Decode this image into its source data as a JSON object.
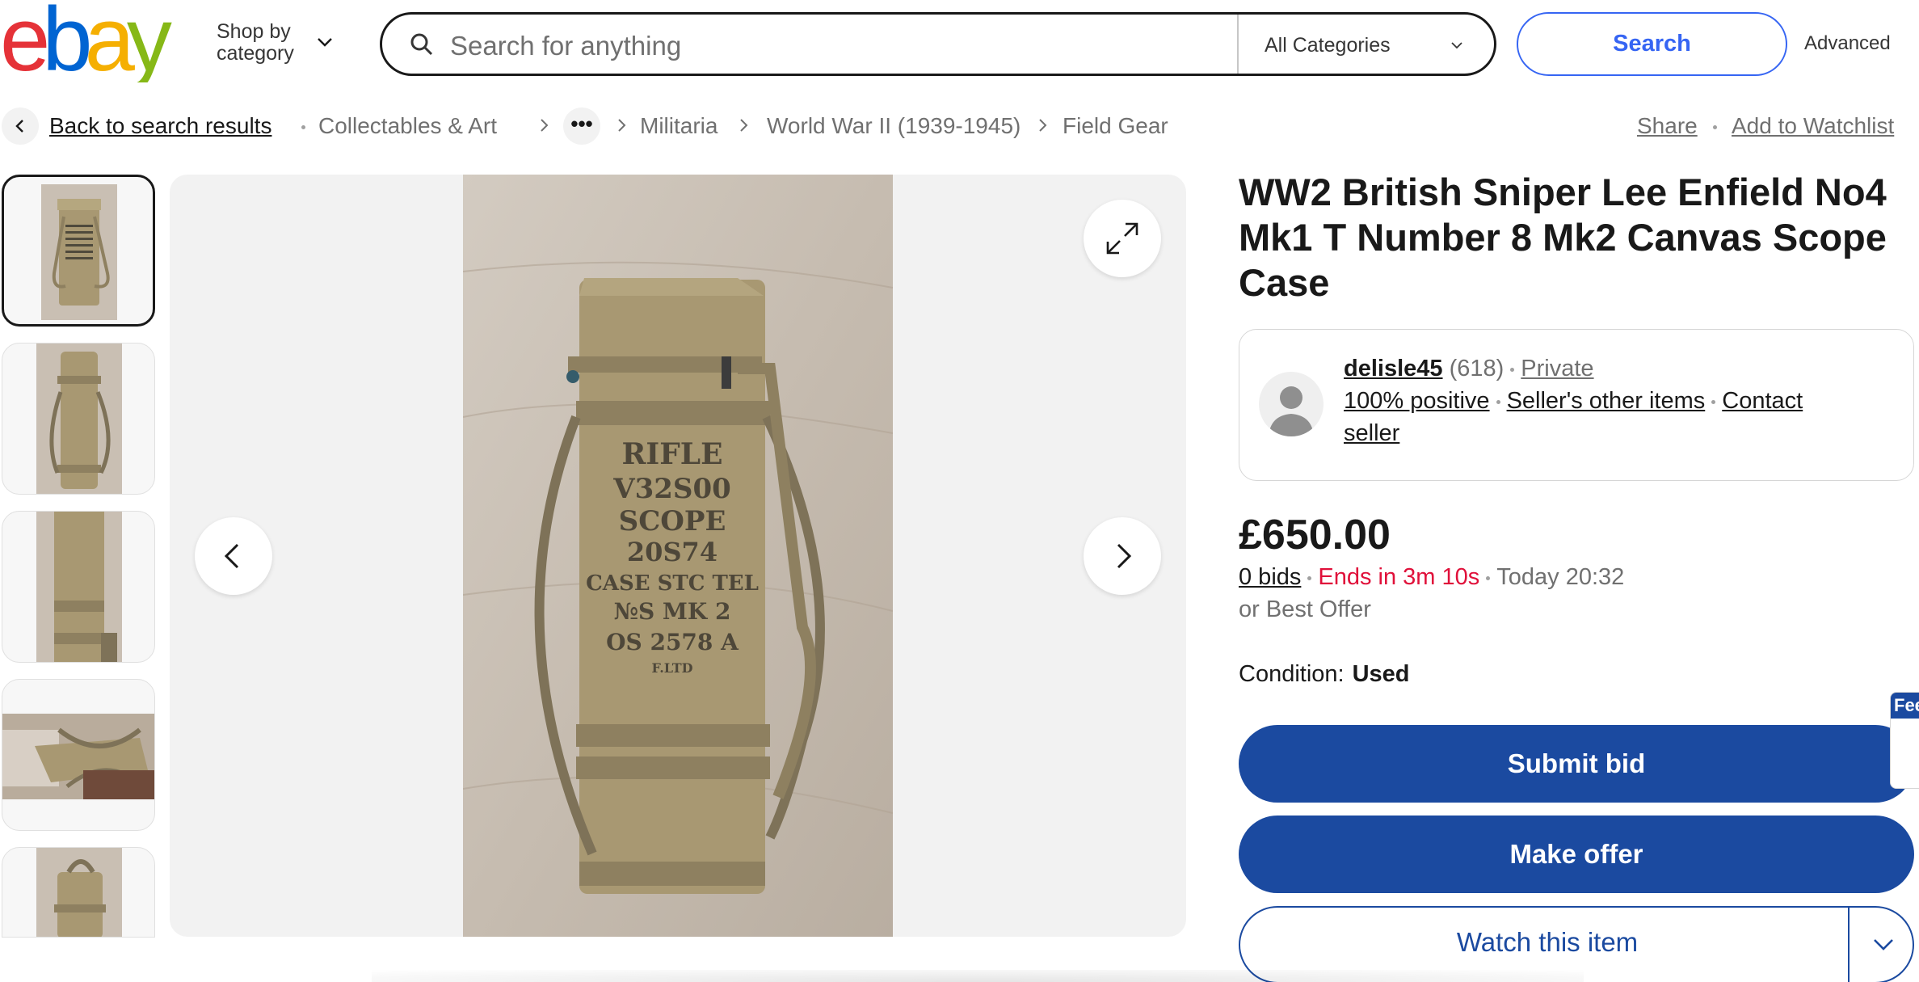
{
  "header": {
    "logo_letters": [
      "e",
      "b",
      "a",
      "y"
    ],
    "logo_colors": [
      "#e53238",
      "#0064d2",
      "#f5af02",
      "#86b817"
    ],
    "shop_by_line1": "Shop by",
    "shop_by_line2": "category",
    "search_placeholder": "Search for anything",
    "category_select": "All Categories",
    "search_button": "Search",
    "advanced_link": "Advanced"
  },
  "breadcrumb": {
    "back": "Back to search results",
    "items": [
      "Collectables & Art",
      "Militaria",
      "World War II (1939-1945)",
      "Field Gear"
    ],
    "more": "•••",
    "share": "Share",
    "watchlist": "Add to Watchlist"
  },
  "listing": {
    "title": "WW2 British Sniper Lee Enfield No4 Mk1 T Number 8 Mk2 Canvas Scope Case",
    "seller": {
      "name": "delisle45",
      "count": "(618)",
      "type": "Private",
      "positive": "100% positive",
      "other_items": "Seller's other items",
      "contact_line1": "Contact",
      "contact_line2": "seller"
    },
    "price": "£650.00",
    "bids": "0 bids",
    "ends": "Ends in 3m 10s",
    "end_time": "Today 20:32",
    "best_offer": "or Best Offer",
    "condition_label": "Condition:",
    "condition_value": "Used",
    "submit_bid": "Submit bid",
    "make_offer": "Make offer",
    "watch_item": "Watch this item",
    "feedback_tab": "Fee"
  },
  "photo_stencil": [
    "RIFLE",
    "V32S00",
    "SCOPE",
    "20S74",
    "CASE STC TEL",
    "№S MK 2",
    "OS 2578 A",
    "F.LTD"
  ],
  "colors": {
    "primary_button": "#1b4aa0",
    "search_accent": "#3665f3",
    "ends_red": "#e0103a",
    "canvas_khaki": "#a89872",
    "floor": "#c9bfb3"
  },
  "icons": [
    "search-icon",
    "chevron-down-icon",
    "chevron-left-icon",
    "chevron-right-icon",
    "expand-icon",
    "avatar-icon"
  ]
}
